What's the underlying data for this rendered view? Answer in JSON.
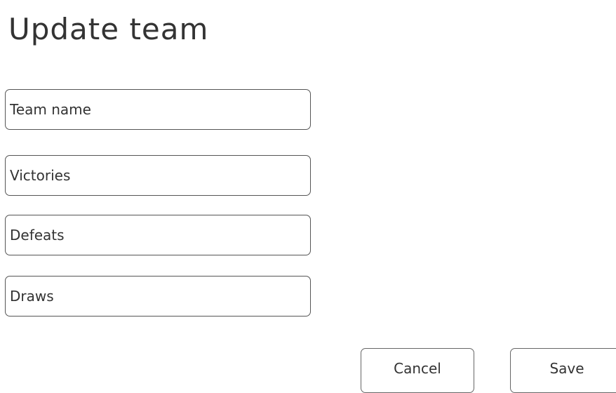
{
  "page": {
    "title": "Update team"
  },
  "form": {
    "team_name_placeholder": "Team name",
    "victories_placeholder": "Victories",
    "defeats_placeholder": "Defeats",
    "draws_placeholder": "Draws"
  },
  "actions": {
    "cancel_label": "Cancel",
    "save_label": "Save"
  }
}
